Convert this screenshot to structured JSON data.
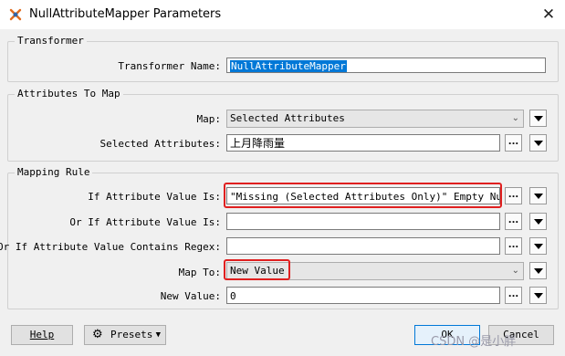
{
  "window": {
    "title": "NullAttributeMapper Parameters",
    "close_glyph": "✕"
  },
  "transformer": {
    "group_title": "Transformer",
    "name_label": "Transformer Name:",
    "name_value": "NullAttributeMapper"
  },
  "attributes": {
    "group_title": "Attributes To Map",
    "map_label": "Map:",
    "map_value": "Selected Attributes",
    "selected_label": "Selected Attributes:",
    "selected_value": "上月降雨量"
  },
  "mapping": {
    "group_title": "Mapping Rule",
    "if_label": "If Attribute Value Is:",
    "if_value": "\"Missing (Selected Attributes Only)\" Empty Null",
    "or_if_label": "Or If Attribute Value Is:",
    "or_if_value": "",
    "regex_label": "Or If Attribute Value Contains Regex:",
    "regex_value": "",
    "map_to_label": "Map To:",
    "map_to_value": "New Value",
    "new_value_label": "New Value:",
    "new_value_value": "0"
  },
  "buttons": {
    "help": "Help",
    "presets": "Presets",
    "ok": "OK",
    "cancel": "Cancel",
    "ellipsis": "..."
  },
  "watermark": "CSDN @是小胖"
}
